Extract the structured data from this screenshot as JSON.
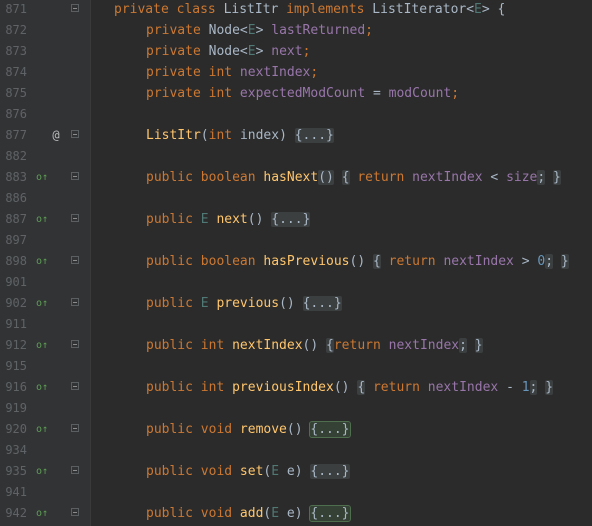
{
  "editor": {
    "lines": [
      {
        "n": "871",
        "mark": "",
        "fold": true,
        "indent": 0,
        "tokens": [
          {
            "c": "kw",
            "t": "private class "
          },
          {
            "c": "id",
            "t": "ListItr "
          },
          {
            "c": "kw",
            "t": "implements "
          },
          {
            "c": "id",
            "t": "ListIterator<"
          },
          {
            "c": "tp",
            "t": "E"
          },
          {
            "c": "id",
            "t": "> {"
          }
        ]
      },
      {
        "n": "872",
        "mark": "",
        "fold": false,
        "indent": 1,
        "tokens": [
          {
            "c": "kw",
            "t": "private "
          },
          {
            "c": "id",
            "t": "Node<"
          },
          {
            "c": "tp",
            "t": "E"
          },
          {
            "c": "id",
            "t": "> "
          },
          {
            "c": "fld",
            "t": "lastReturned"
          },
          {
            "c": "kw",
            "t": ";"
          }
        ]
      },
      {
        "n": "873",
        "mark": "",
        "fold": false,
        "indent": 1,
        "tokens": [
          {
            "c": "kw",
            "t": "private "
          },
          {
            "c": "id",
            "t": "Node<"
          },
          {
            "c": "tp",
            "t": "E"
          },
          {
            "c": "id",
            "t": "> "
          },
          {
            "c": "fld",
            "t": "next"
          },
          {
            "c": "kw",
            "t": ";"
          }
        ]
      },
      {
        "n": "874",
        "mark": "",
        "fold": false,
        "indent": 1,
        "tokens": [
          {
            "c": "kw",
            "t": "private int "
          },
          {
            "c": "fld",
            "t": "nextIndex"
          },
          {
            "c": "kw",
            "t": ";"
          }
        ]
      },
      {
        "n": "875",
        "mark": "",
        "fold": false,
        "indent": 1,
        "tokens": [
          {
            "c": "kw",
            "t": "private int "
          },
          {
            "c": "fld",
            "t": "expectedModCount "
          },
          {
            "c": "id",
            "t": "= "
          },
          {
            "c": "fld",
            "t": "modCount"
          },
          {
            "c": "kw",
            "t": ";"
          }
        ]
      },
      {
        "n": "876",
        "mark": "",
        "fold": false,
        "indent": 0,
        "tokens": []
      },
      {
        "n": "877",
        "mark": "@",
        "fold": true,
        "indent": 1,
        "tokens": [
          {
            "c": "fn",
            "t": "ListItr"
          },
          {
            "c": "id",
            "t": "("
          },
          {
            "c": "kw",
            "t": "int "
          },
          {
            "c": "id",
            "t": "index) "
          },
          {
            "c": "fb",
            "t": "{...}"
          }
        ]
      },
      {
        "n": "882",
        "mark": "",
        "fold": false,
        "indent": 0,
        "tokens": []
      },
      {
        "n": "883",
        "mark": "o↑",
        "fold": true,
        "indent": 1,
        "tokens": [
          {
            "c": "kw",
            "t": "public boolean "
          },
          {
            "c": "fn",
            "t": "hasNext"
          },
          {
            "c": "fb",
            "t": "()"
          },
          {
            "c": "id",
            "t": " "
          },
          {
            "c": "fb",
            "t": "{"
          },
          {
            "c": "kw",
            "t": " return "
          },
          {
            "c": "fld",
            "t": "nextIndex "
          },
          {
            "c": "id",
            "t": "< "
          },
          {
            "c": "fld",
            "t": "size"
          },
          {
            "c": "fb",
            "t": ";"
          },
          {
            "c": "id",
            "t": " "
          },
          {
            "c": "fb",
            "t": "}"
          }
        ]
      },
      {
        "n": "886",
        "mark": "",
        "fold": false,
        "indent": 0,
        "tokens": []
      },
      {
        "n": "887",
        "mark": "o↑",
        "fold": true,
        "indent": 1,
        "tokens": [
          {
            "c": "kw",
            "t": "public "
          },
          {
            "c": "tp",
            "t": "E "
          },
          {
            "c": "fn",
            "t": "next"
          },
          {
            "c": "id",
            "t": "() "
          },
          {
            "c": "fb",
            "t": "{...}"
          }
        ]
      },
      {
        "n": "897",
        "mark": "",
        "fold": false,
        "indent": 0,
        "tokens": []
      },
      {
        "n": "898",
        "mark": "o↑",
        "fold": true,
        "indent": 1,
        "tokens": [
          {
            "c": "kw",
            "t": "public boolean "
          },
          {
            "c": "fn",
            "t": "hasPrevious"
          },
          {
            "c": "id",
            "t": "()"
          },
          {
            "c": "id",
            "t": " "
          },
          {
            "c": "fb",
            "t": "{"
          },
          {
            "c": "kw",
            "t": " return "
          },
          {
            "c": "fld",
            "t": "nextIndex "
          },
          {
            "c": "id",
            "t": "> "
          },
          {
            "c": "num",
            "t": "0"
          },
          {
            "c": "fb",
            "t": ";"
          },
          {
            "c": "id",
            "t": " "
          },
          {
            "c": "fb",
            "t": "}"
          }
        ]
      },
      {
        "n": "901",
        "mark": "",
        "fold": false,
        "indent": 0,
        "tokens": []
      },
      {
        "n": "902",
        "mark": "o↑",
        "fold": true,
        "indent": 1,
        "tokens": [
          {
            "c": "kw",
            "t": "public "
          },
          {
            "c": "tp",
            "t": "E "
          },
          {
            "c": "fn",
            "t": "previous"
          },
          {
            "c": "id",
            "t": "() "
          },
          {
            "c": "fb",
            "t": "{...}"
          }
        ]
      },
      {
        "n": "911",
        "mark": "",
        "fold": false,
        "indent": 0,
        "tokens": []
      },
      {
        "n": "912",
        "mark": "o↑",
        "fold": true,
        "indent": 1,
        "tokens": [
          {
            "c": "kw",
            "t": "public int "
          },
          {
            "c": "fn",
            "t": "nextIndex"
          },
          {
            "c": "id",
            "t": "()"
          },
          {
            "c": "id",
            "t": " "
          },
          {
            "c": "fb",
            "t": "{"
          },
          {
            "c": "kw",
            "t": "return "
          },
          {
            "c": "fld",
            "t": "nextIndex"
          },
          {
            "c": "fb",
            "t": ";"
          },
          {
            "c": "id",
            "t": " "
          },
          {
            "c": "fb",
            "t": "}"
          }
        ]
      },
      {
        "n": "915",
        "mark": "",
        "fold": false,
        "indent": 0,
        "tokens": []
      },
      {
        "n": "916",
        "mark": "o↑",
        "fold": true,
        "indent": 1,
        "tokens": [
          {
            "c": "kw",
            "t": "public int "
          },
          {
            "c": "fn",
            "t": "previousIndex"
          },
          {
            "c": "id",
            "t": "()"
          },
          {
            "c": "id",
            "t": " "
          },
          {
            "c": "fb",
            "t": "{"
          },
          {
            "c": "kw",
            "t": " return "
          },
          {
            "c": "fld",
            "t": "nextIndex "
          },
          {
            "c": "id",
            "t": "- "
          },
          {
            "c": "num",
            "t": "1"
          },
          {
            "c": "fb",
            "t": ";"
          },
          {
            "c": "id",
            "t": " "
          },
          {
            "c": "fb",
            "t": "}"
          }
        ]
      },
      {
        "n": "919",
        "mark": "",
        "fold": false,
        "indent": 0,
        "tokens": []
      },
      {
        "n": "920",
        "mark": "o↑",
        "fold": true,
        "indent": 1,
        "tokens": [
          {
            "c": "kw",
            "t": "public void "
          },
          {
            "c": "fn",
            "t": "remove"
          },
          {
            "c": "id",
            "t": "() "
          },
          {
            "c": "fb-green",
            "t": "{...}"
          }
        ]
      },
      {
        "n": "934",
        "mark": "",
        "fold": false,
        "indent": 0,
        "tokens": []
      },
      {
        "n": "935",
        "mark": "o↑",
        "fold": true,
        "indent": 1,
        "tokens": [
          {
            "c": "kw",
            "t": "public void "
          },
          {
            "c": "fn",
            "t": "set"
          },
          {
            "c": "id",
            "t": "("
          },
          {
            "c": "tp",
            "t": "E "
          },
          {
            "c": "id",
            "t": "e) "
          },
          {
            "c": "fb",
            "t": "{...}"
          }
        ]
      },
      {
        "n": "941",
        "mark": "",
        "fold": false,
        "indent": 0,
        "tokens": []
      },
      {
        "n": "942",
        "mark": "o↑",
        "fold": true,
        "indent": 1,
        "tokens": [
          {
            "c": "kw",
            "t": "public void "
          },
          {
            "c": "fn",
            "t": "add"
          },
          {
            "c": "id",
            "t": "("
          },
          {
            "c": "tp",
            "t": "E "
          },
          {
            "c": "id",
            "t": "e) "
          },
          {
            "c": "fb-green",
            "t": "{...}"
          }
        ]
      }
    ]
  },
  "colors": {
    "background": "#2b2b2b",
    "gutter": "#313335",
    "keyword": "#cc7832",
    "identifier": "#a9b7c6",
    "field": "#9876aa",
    "type_param": "#507874",
    "method": "#ffc66d",
    "number": "#6897bb",
    "override_marker": "#5f9e55"
  },
  "icons": {
    "override_marker": "override-up-arrow-icon",
    "annotation_marker": "at-icon",
    "fold": "fold-toggle-icon"
  }
}
